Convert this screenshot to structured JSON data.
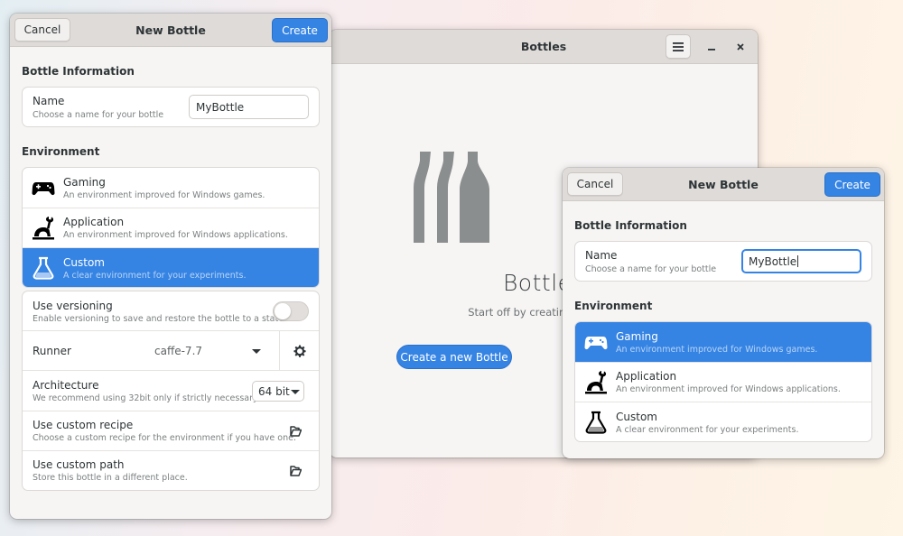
{
  "main_window": {
    "title": "Bottles",
    "menu_icon": "hamburger-menu-icon",
    "minimize_icon": "minimize-icon",
    "close_icon": "close-icon",
    "empty_state": {
      "icon": "bottles-logo-icon",
      "title": "Bottles",
      "subtitle": "Start off by creating a Bottle.",
      "button_label": "Create a new Bottle"
    }
  },
  "dialog_left": {
    "title": "New Bottle",
    "cancel_label": "Cancel",
    "create_label": "Create",
    "bottle_info_title": "Bottle Information",
    "name": {
      "label": "Name",
      "sublabel": "Choose a name for your bottle",
      "value": "MyBottle"
    },
    "environment_title": "Environment",
    "environments": [
      {
        "icon": "gamepad-icon",
        "title": "Gaming",
        "subtitle": "An environment improved for Windows games.",
        "selected": false
      },
      {
        "icon": "application-icon",
        "title": "Application",
        "subtitle": "An environment improved for Windows applications.",
        "selected": false
      },
      {
        "icon": "flask-icon",
        "title": "Custom",
        "subtitle": "A clear environment for your experiments.",
        "selected": true
      }
    ],
    "options": {
      "versioning": {
        "title": "Use versioning",
        "subtitle": "Enable versioning to save and restore the bottle to a state.",
        "enabled": false
      },
      "runner": {
        "title": "Runner",
        "value": "caffe-7.7",
        "settings_icon": "gear-icon"
      },
      "architecture": {
        "title": "Architecture",
        "subtitle": "We recommend using 32bit only if strictly necessary",
        "value": "64 bit"
      },
      "custom_recipe": {
        "title": "Use custom recipe",
        "subtitle": "Choose a custom recipe for the environment if you have one.",
        "icon": "folder-open-icon"
      },
      "custom_path": {
        "title": "Use custom path",
        "subtitle": "Store this bottle in a different place.",
        "icon": "folder-open-icon"
      }
    }
  },
  "dialog_right": {
    "title": "New Bottle",
    "cancel_label": "Cancel",
    "create_label": "Create",
    "bottle_info_title": "Bottle Information",
    "name": {
      "label": "Name",
      "sublabel": "Choose a name for your bottle",
      "value": "MyBottle"
    },
    "environment_title": "Environment",
    "environments": [
      {
        "icon": "gamepad-icon",
        "title": "Gaming",
        "subtitle": "An environment improved for Windows games.",
        "selected": true
      },
      {
        "icon": "application-icon",
        "title": "Application",
        "subtitle": "An environment improved for Windows applications.",
        "selected": false
      },
      {
        "icon": "flask-icon",
        "title": "Custom",
        "subtitle": "A clear environment for your experiments.",
        "selected": false
      }
    ]
  },
  "colors": {
    "accent": "#3584e4",
    "headerbar": "#dedbd8",
    "window_bg": "#f6f5f4",
    "bottle_logo": "#8b8e8f"
  }
}
